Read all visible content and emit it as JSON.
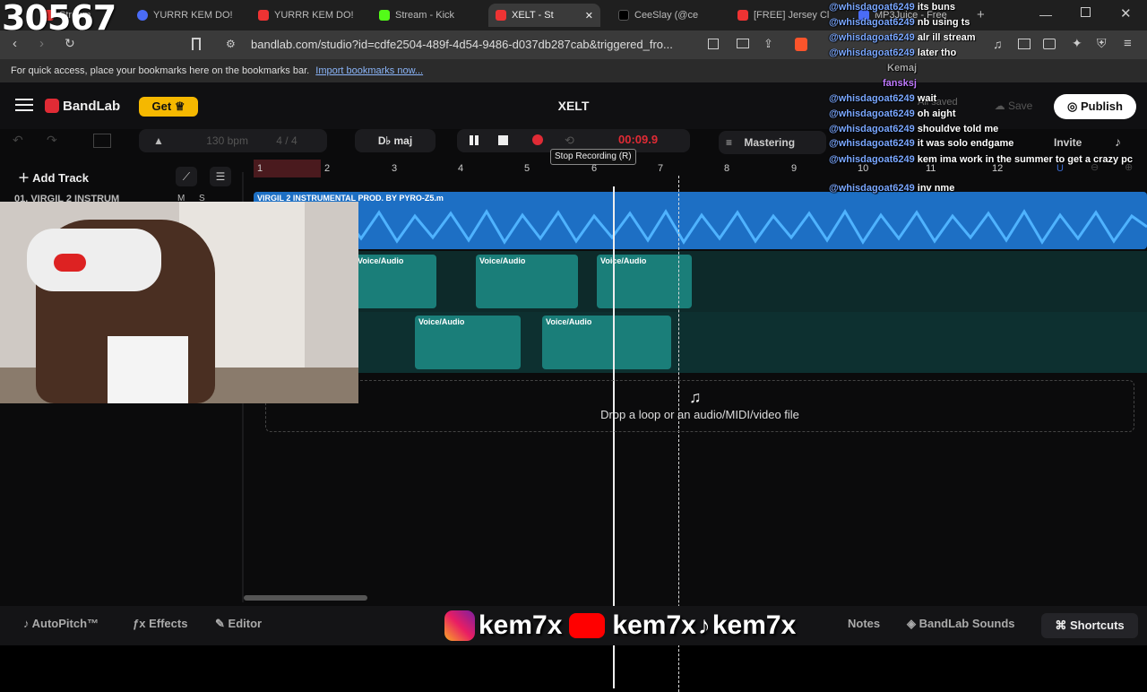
{
  "stream": {
    "view_count": "30567",
    "social_handle": "kem7x"
  },
  "tabs": [
    {
      "label": "Stream",
      "color": "#e33"
    },
    {
      "label": "YURRR KEM DO!",
      "color": "#4a6cf7"
    },
    {
      "label": "YURRR KEM DO!",
      "color": "#e33"
    },
    {
      "label": "Stream - Kick",
      "color": "#53fc18"
    },
    {
      "label": "XELT - St",
      "color": "#e33"
    },
    {
      "label": "CeeSlay (@ce",
      "color": "#000"
    },
    {
      "label": "[FREE] Jersey Cl",
      "color": "#e33"
    },
    {
      "label": "MP3Juice - Free",
      "color": "#4a6cf7"
    }
  ],
  "address_bar": {
    "url": "bandlab.com/studio?id=cdfe2504-489f-4d54-9486-d037db287cab&triggered_fro..."
  },
  "bookmarks_bar": {
    "text": "For quick access, place your bookmarks here on the bookmarks bar.",
    "link": "Import bookmarks now..."
  },
  "app": {
    "brand": "BandLab",
    "get_label": "Get",
    "project_title": "XELT",
    "save_label": "Save",
    "saved_status": "All saved",
    "publish_label": "Publish",
    "bpm": "130",
    "bpm_unit": "bpm",
    "time_signature": "4 / 4",
    "key": "D♭ maj",
    "timer": "00:09.9",
    "tooltip": "Stop Recording (R)",
    "mastering_label": "Mastering",
    "invite_label": "Invite",
    "add_track_label": "Add Track",
    "track_name": "01. VIRGIL 2 INSTRUM",
    "track_m": "M",
    "track_s": "S",
    "timeline_ticks": [
      "1",
      "2",
      "3",
      "4",
      "5",
      "6",
      "7",
      "8",
      "9",
      "10",
      "11",
      "12"
    ],
    "beat_clip_label": "VIRGIL 2 INSTRUMENTAL PROD. BY PYRO-Z5.m",
    "voice_clip_label": "Voice/Audio",
    "drop_text": "Drop a loop or an audio/MIDI/video file",
    "accent": "#e02b35",
    "beat_color": "#2a8fe0",
    "voice_color": "#1e8a85"
  },
  "footer": {
    "autopitch": "AutoPitch™",
    "effects": "Effects",
    "editor": "Editor",
    "notes": "Notes",
    "sounds": "BandLab Sounds",
    "shortcuts": "Shortcuts"
  },
  "chat": [
    {
      "user": "@whisdagoat6249",
      "msg": "its buns"
    },
    {
      "user": "@whisdagoat6249",
      "msg": "nb using ts"
    },
    {
      "user": "@whisdagoat6249",
      "msg": "alr ill stream"
    },
    {
      "user": "@whisdagoat6249",
      "msg": "later tho"
    },
    {
      "user": "Kemaj",
      "msg": ""
    },
    {
      "user": "fansksj",
      "msg": ""
    },
    {
      "user": "@whisdagoat6249",
      "msg": "wait"
    },
    {
      "user": "@whisdagoat6249",
      "msg": "oh aight"
    },
    {
      "user": "@whisdagoat6249",
      "msg": "shouldve told me"
    },
    {
      "user": "@whisdagoat6249",
      "msg": "it was solo endgame"
    },
    {
      "user": "@whisdagoat6249",
      "msg": "kem ima work in the summer to get a crazy pc"
    },
    {
      "user": "@whisdagoat6249",
      "msg": "inv nme"
    }
  ]
}
